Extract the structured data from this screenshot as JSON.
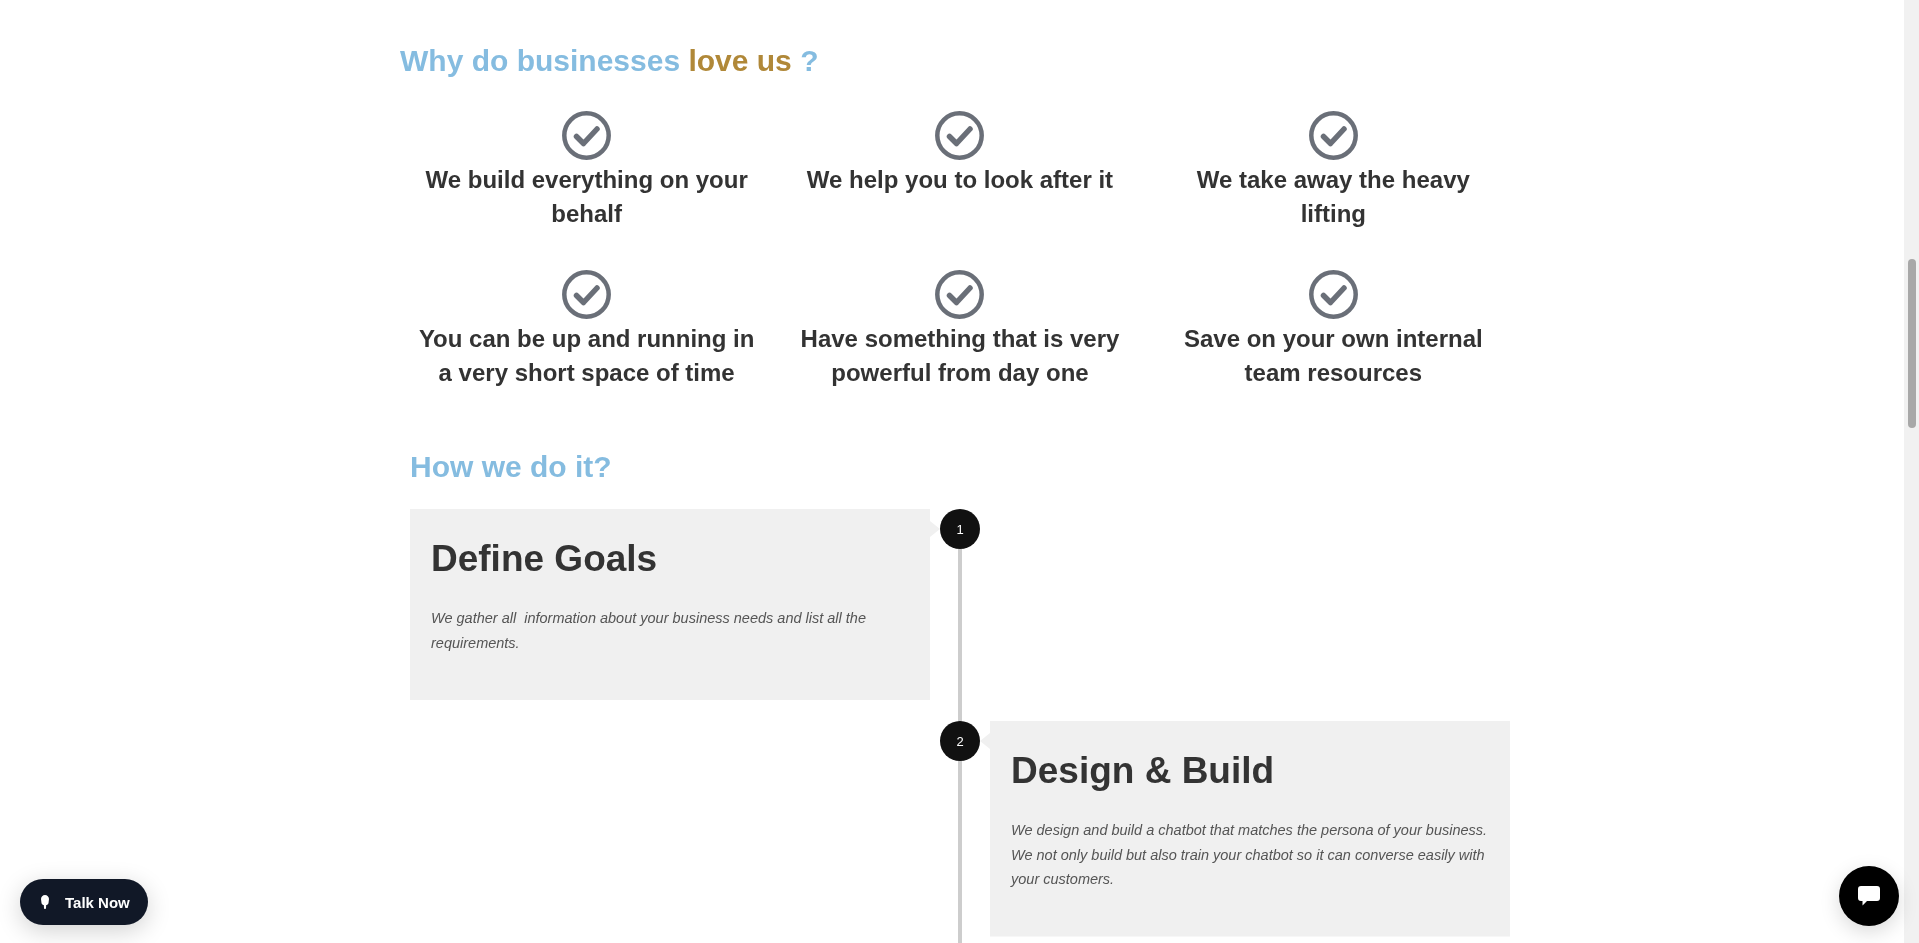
{
  "why_section": {
    "heading": [
      {
        "text": "Why do businesses",
        "highlight": false
      },
      {
        "text": "love us",
        "highlight": true
      },
      {
        "text": "?",
        "highlight": false
      }
    ],
    "benefits": [
      "We build everything on your behalf",
      "We help you to look after it",
      "We take away the heavy lifting",
      "You can be up and running in a very short space of time",
      "Have something that is very powerful from day one",
      "Save on your own internal team resources"
    ]
  },
  "how_section": {
    "heading": "How we do it?",
    "steps": [
      {
        "number": "1",
        "title": "Define Goals",
        "description": "We gather all  information about your business needs and list all the requirements.",
        "kind": "left"
      },
      {
        "number": "2",
        "title": "Design & Build",
        "description": "We design and build a chatbot that matches the persona of your business. We not only build but also train your chatbot so it can converse easily with your customers.",
        "kind": "right"
      }
    ]
  },
  "talk_button": {
    "label": "Talk Now"
  }
}
